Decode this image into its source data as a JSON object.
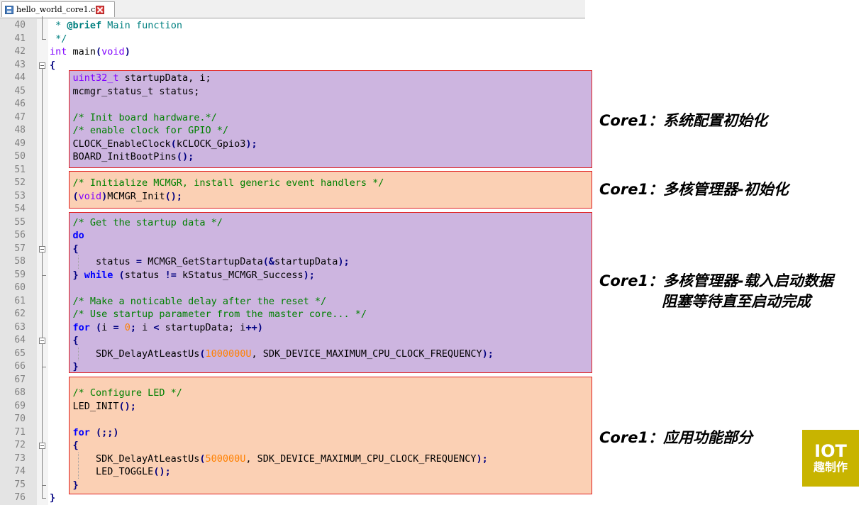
{
  "tab": {
    "filename": "hello_world_core1.c"
  },
  "annotations": [
    "Core1：系统配置初始化",
    "Core1：多核管理器-初始化",
    "Core1：多核管理器-载入启动数据",
    "阻塞等待直至启动完成",
    "Core1：应用功能部分"
  ],
  "logo": {
    "top": "IOT",
    "bottom": "趣制作"
  },
  "colors": {
    "purple_block": "#cdb5e0",
    "orange_block": "#fbd0b4",
    "outline": "#e02020"
  },
  "lines": [
    {
      "n": "40",
      "tokens": [
        [
          "doc",
          " * "
        ],
        [
          "dockw",
          "@brief"
        ],
        [
          "doc",
          " Main function"
        ]
      ]
    },
    {
      "n": "41",
      "tokens": [
        [
          "doc",
          " */"
        ]
      ]
    },
    {
      "n": "42",
      "tokens": [
        [
          "type",
          "int"
        ],
        [
          "fn",
          " main"
        ],
        [
          "op",
          "("
        ],
        [
          "type",
          "void"
        ],
        [
          "op",
          ")"
        ]
      ]
    },
    {
      "n": "43",
      "tokens": [
        [
          "op",
          "{"
        ]
      ]
    },
    {
      "n": "44",
      "tokens": [
        [
          "type",
          "    uint32_t"
        ],
        [
          "fn",
          " startupData, i;"
        ]
      ]
    },
    {
      "n": "45",
      "tokens": [
        [
          "fn",
          "    mcmgr_status_t status;"
        ]
      ]
    },
    {
      "n": "46",
      "tokens": []
    },
    {
      "n": "47",
      "tokens": [
        [
          "cm",
          "    /* Init board hardware.*/"
        ]
      ]
    },
    {
      "n": "48",
      "tokens": [
        [
          "cm",
          "    /* enable clock for GPIO */"
        ]
      ]
    },
    {
      "n": "49",
      "tokens": [
        [
          "fn",
          "    CLOCK_EnableClock"
        ],
        [
          "op",
          "("
        ],
        [
          "fn",
          "kCLOCK_Gpio3"
        ],
        [
          "op",
          ");"
        ]
      ]
    },
    {
      "n": "50",
      "tokens": [
        [
          "fn",
          "    BOARD_InitBootPins"
        ],
        [
          "op",
          "();"
        ]
      ]
    },
    {
      "n": "51",
      "tokens": []
    },
    {
      "n": "52",
      "tokens": [
        [
          "cm",
          "    /* Initialize MCMGR, install generic event handlers */"
        ]
      ]
    },
    {
      "n": "53",
      "tokens": [
        [
          "op",
          "    ("
        ],
        [
          "type",
          "void"
        ],
        [
          "op",
          ")"
        ],
        [
          "fn",
          "MCMGR_Init"
        ],
        [
          "op",
          "();"
        ]
      ]
    },
    {
      "n": "54",
      "tokens": []
    },
    {
      "n": "55",
      "tokens": [
        [
          "cm",
          "    /* Get the startup data */"
        ]
      ]
    },
    {
      "n": "56",
      "tokens": [
        [
          "kw",
          "    do"
        ]
      ]
    },
    {
      "n": "57",
      "tokens": [
        [
          "op",
          "    {"
        ]
      ]
    },
    {
      "n": "58",
      "tokens": [
        [
          "fn",
          "        status "
        ],
        [
          "op",
          "="
        ],
        [
          "fn",
          " MCMGR_GetStartupData"
        ],
        [
          "op",
          "(&"
        ],
        [
          "fn",
          "startupData"
        ],
        [
          "op",
          ");"
        ]
      ]
    },
    {
      "n": "59",
      "tokens": [
        [
          "op",
          "    }"
        ],
        [
          "kw",
          " while"
        ],
        [
          "op",
          " ("
        ],
        [
          "fn",
          "status "
        ],
        [
          "op",
          "!="
        ],
        [
          "fn",
          " kStatus_MCMGR_Success"
        ],
        [
          "op",
          ");"
        ]
      ]
    },
    {
      "n": "60",
      "tokens": []
    },
    {
      "n": "61",
      "tokens": [
        [
          "cm",
          "    /* Make a noticable delay after the reset */"
        ]
      ]
    },
    {
      "n": "62",
      "tokens": [
        [
          "cm",
          "    /* Use startup parameter from the master core... */"
        ]
      ]
    },
    {
      "n": "63",
      "tokens": [
        [
          "kw",
          "    for"
        ],
        [
          "op",
          " ("
        ],
        [
          "fn",
          "i "
        ],
        [
          "op",
          "="
        ],
        [
          "num",
          " 0"
        ],
        [
          "op",
          ";"
        ],
        [
          "fn",
          " i "
        ],
        [
          "op",
          "<"
        ],
        [
          "fn",
          " startupData; i"
        ],
        [
          "op",
          "++)"
        ]
      ]
    },
    {
      "n": "64",
      "tokens": [
        [
          "op",
          "    {"
        ]
      ]
    },
    {
      "n": "65",
      "tokens": [
        [
          "fn",
          "        SDK_DelayAtLeastUs"
        ],
        [
          "op",
          "("
        ],
        [
          "num",
          "1000000U"
        ],
        [
          "fn",
          ", SDK_DEVICE_MAXIMUM_CPU_CLOCK_FREQUENCY"
        ],
        [
          "op",
          ");"
        ]
      ]
    },
    {
      "n": "66",
      "tokens": [
        [
          "op",
          "    }"
        ]
      ]
    },
    {
      "n": "67",
      "tokens": []
    },
    {
      "n": "68",
      "tokens": [
        [
          "cm",
          "    /* Configure LED */"
        ]
      ]
    },
    {
      "n": "69",
      "tokens": [
        [
          "fn",
          "    LED_INIT"
        ],
        [
          "op",
          "();"
        ]
      ]
    },
    {
      "n": "70",
      "tokens": []
    },
    {
      "n": "71",
      "tokens": [
        [
          "kw",
          "    for"
        ],
        [
          "op",
          " (;;)"
        ]
      ]
    },
    {
      "n": "72",
      "tokens": [
        [
          "op",
          "    {"
        ]
      ]
    },
    {
      "n": "73",
      "tokens": [
        [
          "fn",
          "        SDK_DelayAtLeastUs"
        ],
        [
          "op",
          "("
        ],
        [
          "num",
          "500000U"
        ],
        [
          "fn",
          ", SDK_DEVICE_MAXIMUM_CPU_CLOCK_FREQUENCY"
        ],
        [
          "op",
          ");"
        ]
      ]
    },
    {
      "n": "74",
      "tokens": [
        [
          "fn",
          "        LED_TOGGLE"
        ],
        [
          "op",
          "();"
        ]
      ]
    },
    {
      "n": "75",
      "tokens": [
        [
          "op",
          "    }"
        ]
      ]
    },
    {
      "n": "76",
      "tokens": [
        [
          "op",
          "}"
        ]
      ]
    }
  ]
}
